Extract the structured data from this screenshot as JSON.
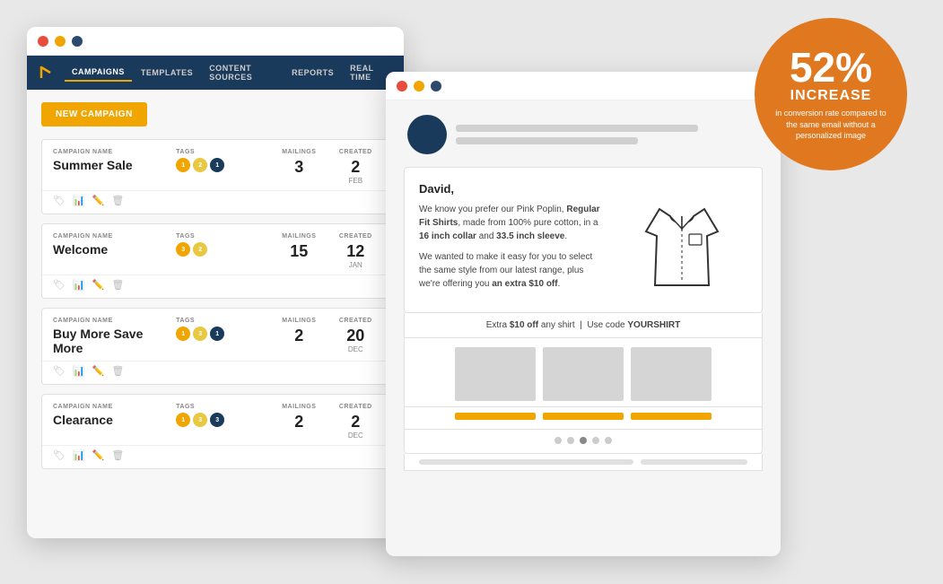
{
  "scene": {
    "background": "#e8e8e8"
  },
  "badge": {
    "percent": "52%",
    "increase": "INCREASE",
    "description": "in conversion rate compared to the same email without a personalized image"
  },
  "left_window": {
    "nav": {
      "items": [
        {
          "label": "CAMPAIGNS",
          "active": true
        },
        {
          "label": "TEMPLATES",
          "active": false
        },
        {
          "label": "CONTENT SOURCES",
          "active": false
        },
        {
          "label": "REPORTS",
          "active": false
        },
        {
          "label": "REAL TIME",
          "active": false
        }
      ]
    },
    "new_campaign_btn": "NEW CAMPAIGN",
    "campaigns": [
      {
        "name": "Summer Sale",
        "campaign_name_label": "CAMPAIGN NAME",
        "tags_label": "TAGS",
        "mailings_label": "MAILINGS",
        "created_label": "CREATED",
        "tags": [
          {
            "color": "orange",
            "count": "1"
          },
          {
            "color": "yellow",
            "count": "2"
          },
          {
            "color": "navy",
            "count": "1"
          }
        ],
        "mailings": "3",
        "created": "2",
        "created_month": "FEB"
      },
      {
        "name": "Welcome",
        "campaign_name_label": "CAMPAIGN NAME",
        "tags_label": "TAGS",
        "mailings_label": "MAILINGS",
        "created_label": "CREATED",
        "tags": [
          {
            "color": "orange",
            "count": "3"
          },
          {
            "color": "yellow",
            "count": "2"
          }
        ],
        "mailings": "15",
        "created": "12",
        "created_month": "JAN"
      },
      {
        "name": "Buy More Save More",
        "campaign_name_label": "CAMPAIGN NAME",
        "tags_label": "TAGS",
        "mailings_label": "MAILINGS",
        "created_label": "CREATED",
        "tags": [
          {
            "color": "orange",
            "count": "1"
          },
          {
            "color": "yellow",
            "count": "3"
          },
          {
            "color": "navy",
            "count": "1"
          }
        ],
        "mailings": "2",
        "created": "20",
        "created_month": "DEC"
      },
      {
        "name": "Clearance",
        "campaign_name_label": "CAMPAIGN NAME",
        "tags_label": "TAGS",
        "mailings_label": "MAILINGS",
        "created_label": "CREATED",
        "tags": [
          {
            "color": "orange",
            "count": "1"
          },
          {
            "color": "yellow",
            "count": "3"
          },
          {
            "color": "navy",
            "count": "3"
          }
        ],
        "mailings": "2",
        "created": "2",
        "created_month": "DEC"
      }
    ]
  },
  "right_window": {
    "email": {
      "greeting": "David,",
      "paragraph1": "We know you prefer our Pink Poplin, Regular Fit Shirts, made from 100% pure cotton, in a 16 inch collar and 33.5 inch sleeve.",
      "paragraph2": "We wanted to make it easy for you to select the same style from our latest range, plus we're offering you an extra $10 off.",
      "promo": "Extra $10 off any shirt  |  Use code YOURSHIRT",
      "nav_dots": 5
    }
  }
}
